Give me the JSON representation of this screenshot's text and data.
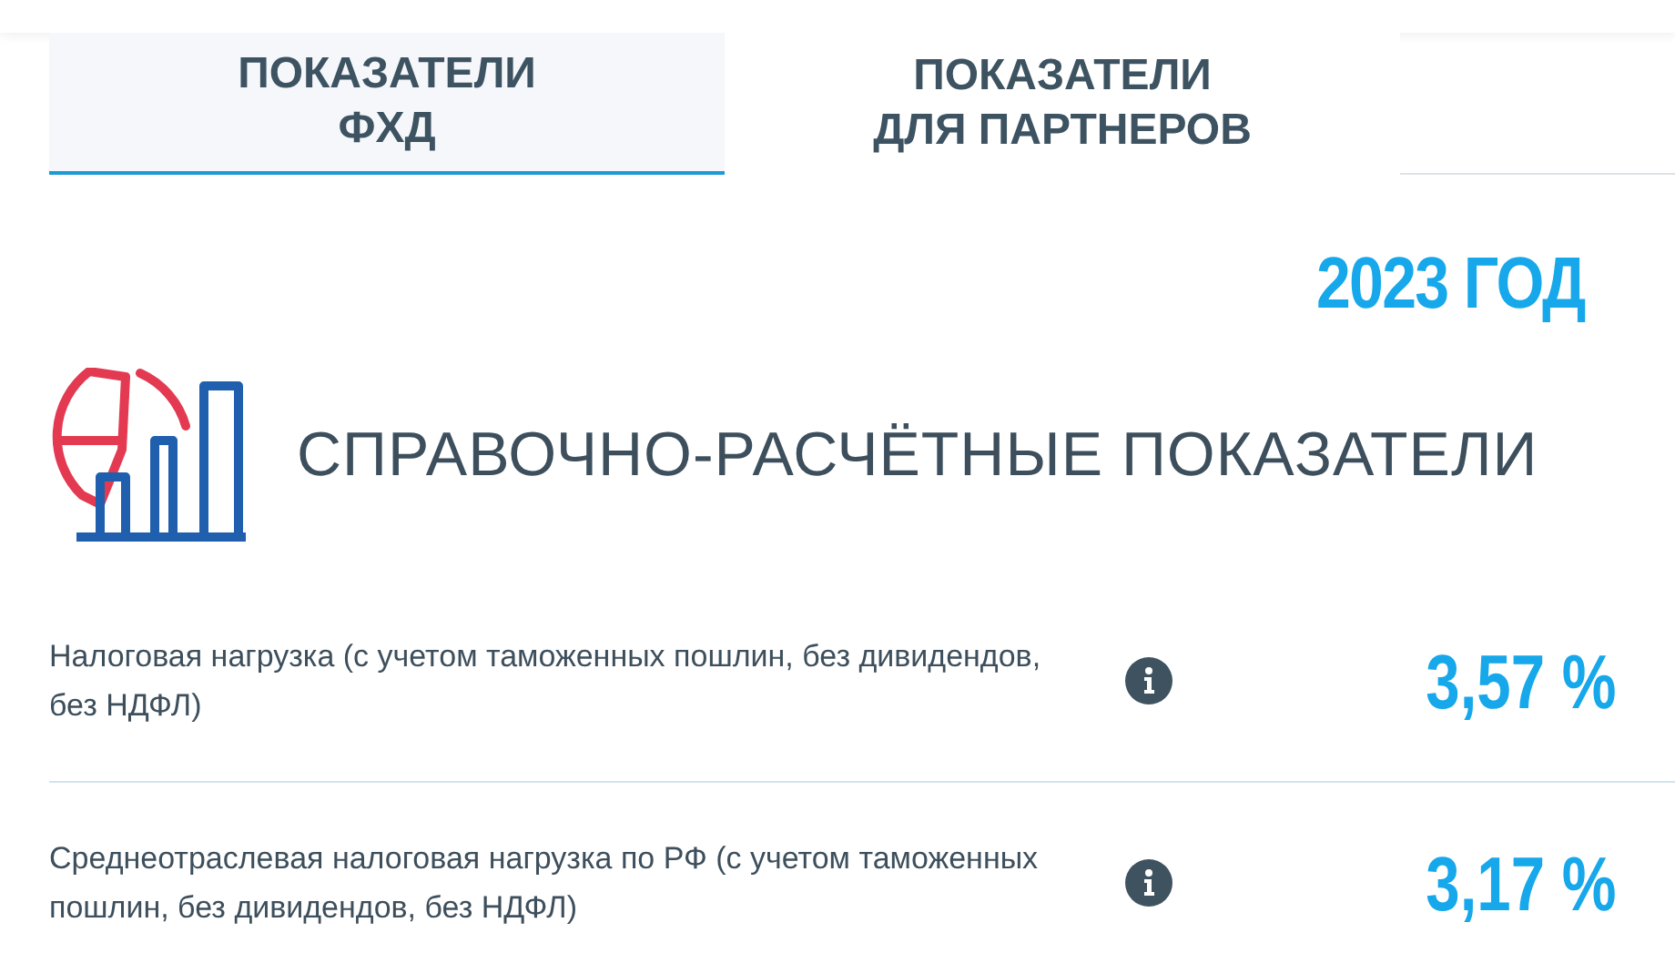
{
  "tabs": [
    {
      "label": "ПОКАЗАТЕЛИ\nФХД",
      "selected": true
    },
    {
      "label": "ПОКАЗАТЕЛИ\nДЛЯ ПАРТНЕРОВ",
      "selected": false
    }
  ],
  "year": "2023 ГОД",
  "section": {
    "title": "СПРАВОЧНО-РАСЧЁТНЫЕ ПОКАЗАТЕЛИ"
  },
  "indicators": [
    {
      "label": "Налоговая нагрузка (с учетом таможенных пошлин, без дивидендов, без НДФЛ)",
      "value": "3,57 %"
    },
    {
      "label": "Среднеотраслевая налоговая нагрузка по РФ (с учетом таможенных пошлин, без дивидендов, без НДФЛ)",
      "value": "3,17 %"
    }
  ]
}
